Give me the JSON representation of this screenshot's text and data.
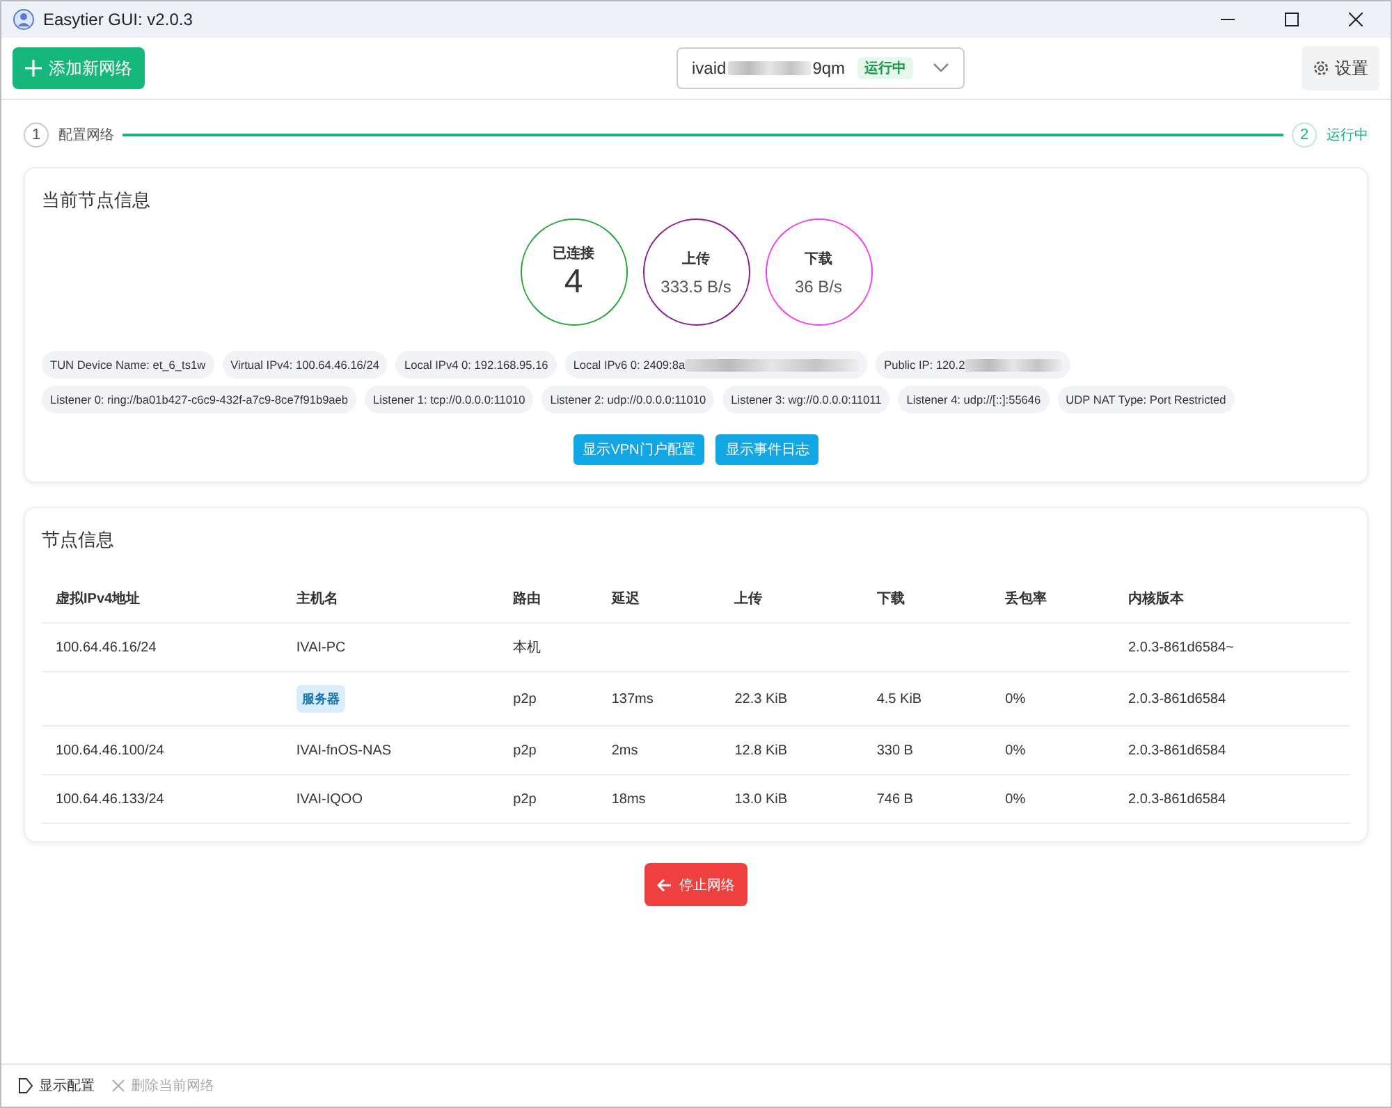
{
  "window": {
    "title": "Easytier GUI: v2.0.3"
  },
  "toolbar": {
    "add_button": "添加新网络",
    "network": {
      "name_start": "ivaid",
      "name_end": "9qm",
      "status": "运行中"
    },
    "settings_button": "设置"
  },
  "steps": [
    {
      "number": "1",
      "label": "配置网络",
      "active": false
    },
    {
      "number": "2",
      "label": "运行中",
      "active": true
    }
  ],
  "node_card": {
    "title": "当前节点信息",
    "stats": [
      {
        "label": "已连接",
        "value": "4",
        "color": "#22a336",
        "big": true
      },
      {
        "label": "上传",
        "value": "333.5 B/s",
        "color": "#8b1a8b",
        "big": false
      },
      {
        "label": "下载",
        "value": "36 B/s",
        "color": "#f03cf0",
        "big": false
      }
    ],
    "chips": [
      {
        "text": "TUN Device Name: et_6_ts1w",
        "redacted": false
      },
      {
        "text": "Virtual IPv4: 100.64.46.16/24",
        "redacted": false
      },
      {
        "text": "Local IPv4 0: 192.168.95.16",
        "redacted": false
      },
      {
        "text": "Local IPv6 0: 2409:8a",
        "redacted": true
      },
      {
        "text": "Public IP: 120.2",
        "redacted": true
      },
      {
        "text": "Listener 0: ring://ba01b427-c6c9-432f-a7c9-8ce7f91b9aeb",
        "redacted": false
      },
      {
        "text": "Listener 1: tcp://0.0.0.0:11010",
        "redacted": false
      },
      {
        "text": "Listener 2: udp://0.0.0.0:11010",
        "redacted": false
      },
      {
        "text": "Listener 3: wg://0.0.0.0:11011",
        "redacted": false
      },
      {
        "text": "Listener 4: udp://[::]:55646",
        "redacted": false
      },
      {
        "text": "UDP NAT Type: Port Restricted",
        "redacted": false
      }
    ],
    "buttons": [
      "显示VPN门户配置",
      "显示事件日志"
    ]
  },
  "peers_card": {
    "title": "节点信息",
    "columns": [
      "虚拟IPv4地址",
      "主机名",
      "路由",
      "延迟",
      "上传",
      "下载",
      "丢包率",
      "内核版本"
    ],
    "rows": [
      {
        "tag": false,
        "cells": [
          "100.64.46.16/24",
          "IVAI-PC",
          "本机",
          "",
          "",
          "",
          "",
          "2.0.3-861d6584~"
        ]
      },
      {
        "tag": true,
        "cells": [
          "",
          "服务器",
          "p2p",
          "137ms",
          "22.3 KiB",
          "4.5 KiB",
          "0%",
          "2.0.3-861d6584"
        ]
      },
      {
        "tag": false,
        "cells": [
          "100.64.46.100/24",
          "IVAI-fnOS-NAS",
          "p2p",
          "2ms",
          "12.8 KiB",
          "330 B",
          "0%",
          "2.0.3-861d6584"
        ]
      },
      {
        "tag": false,
        "cells": [
          "100.64.46.133/24",
          "IVAI-IQOO",
          "p2p",
          "18ms",
          "13.0 KiB",
          "746 B",
          "0%",
          "2.0.3-861d6584"
        ]
      }
    ]
  },
  "stop_button": "停止网络",
  "footer": [
    {
      "label": "显示配置",
      "disabled": false,
      "kind": "show"
    },
    {
      "label": "删除当前网络",
      "disabled": true,
      "kind": "delete"
    }
  ]
}
